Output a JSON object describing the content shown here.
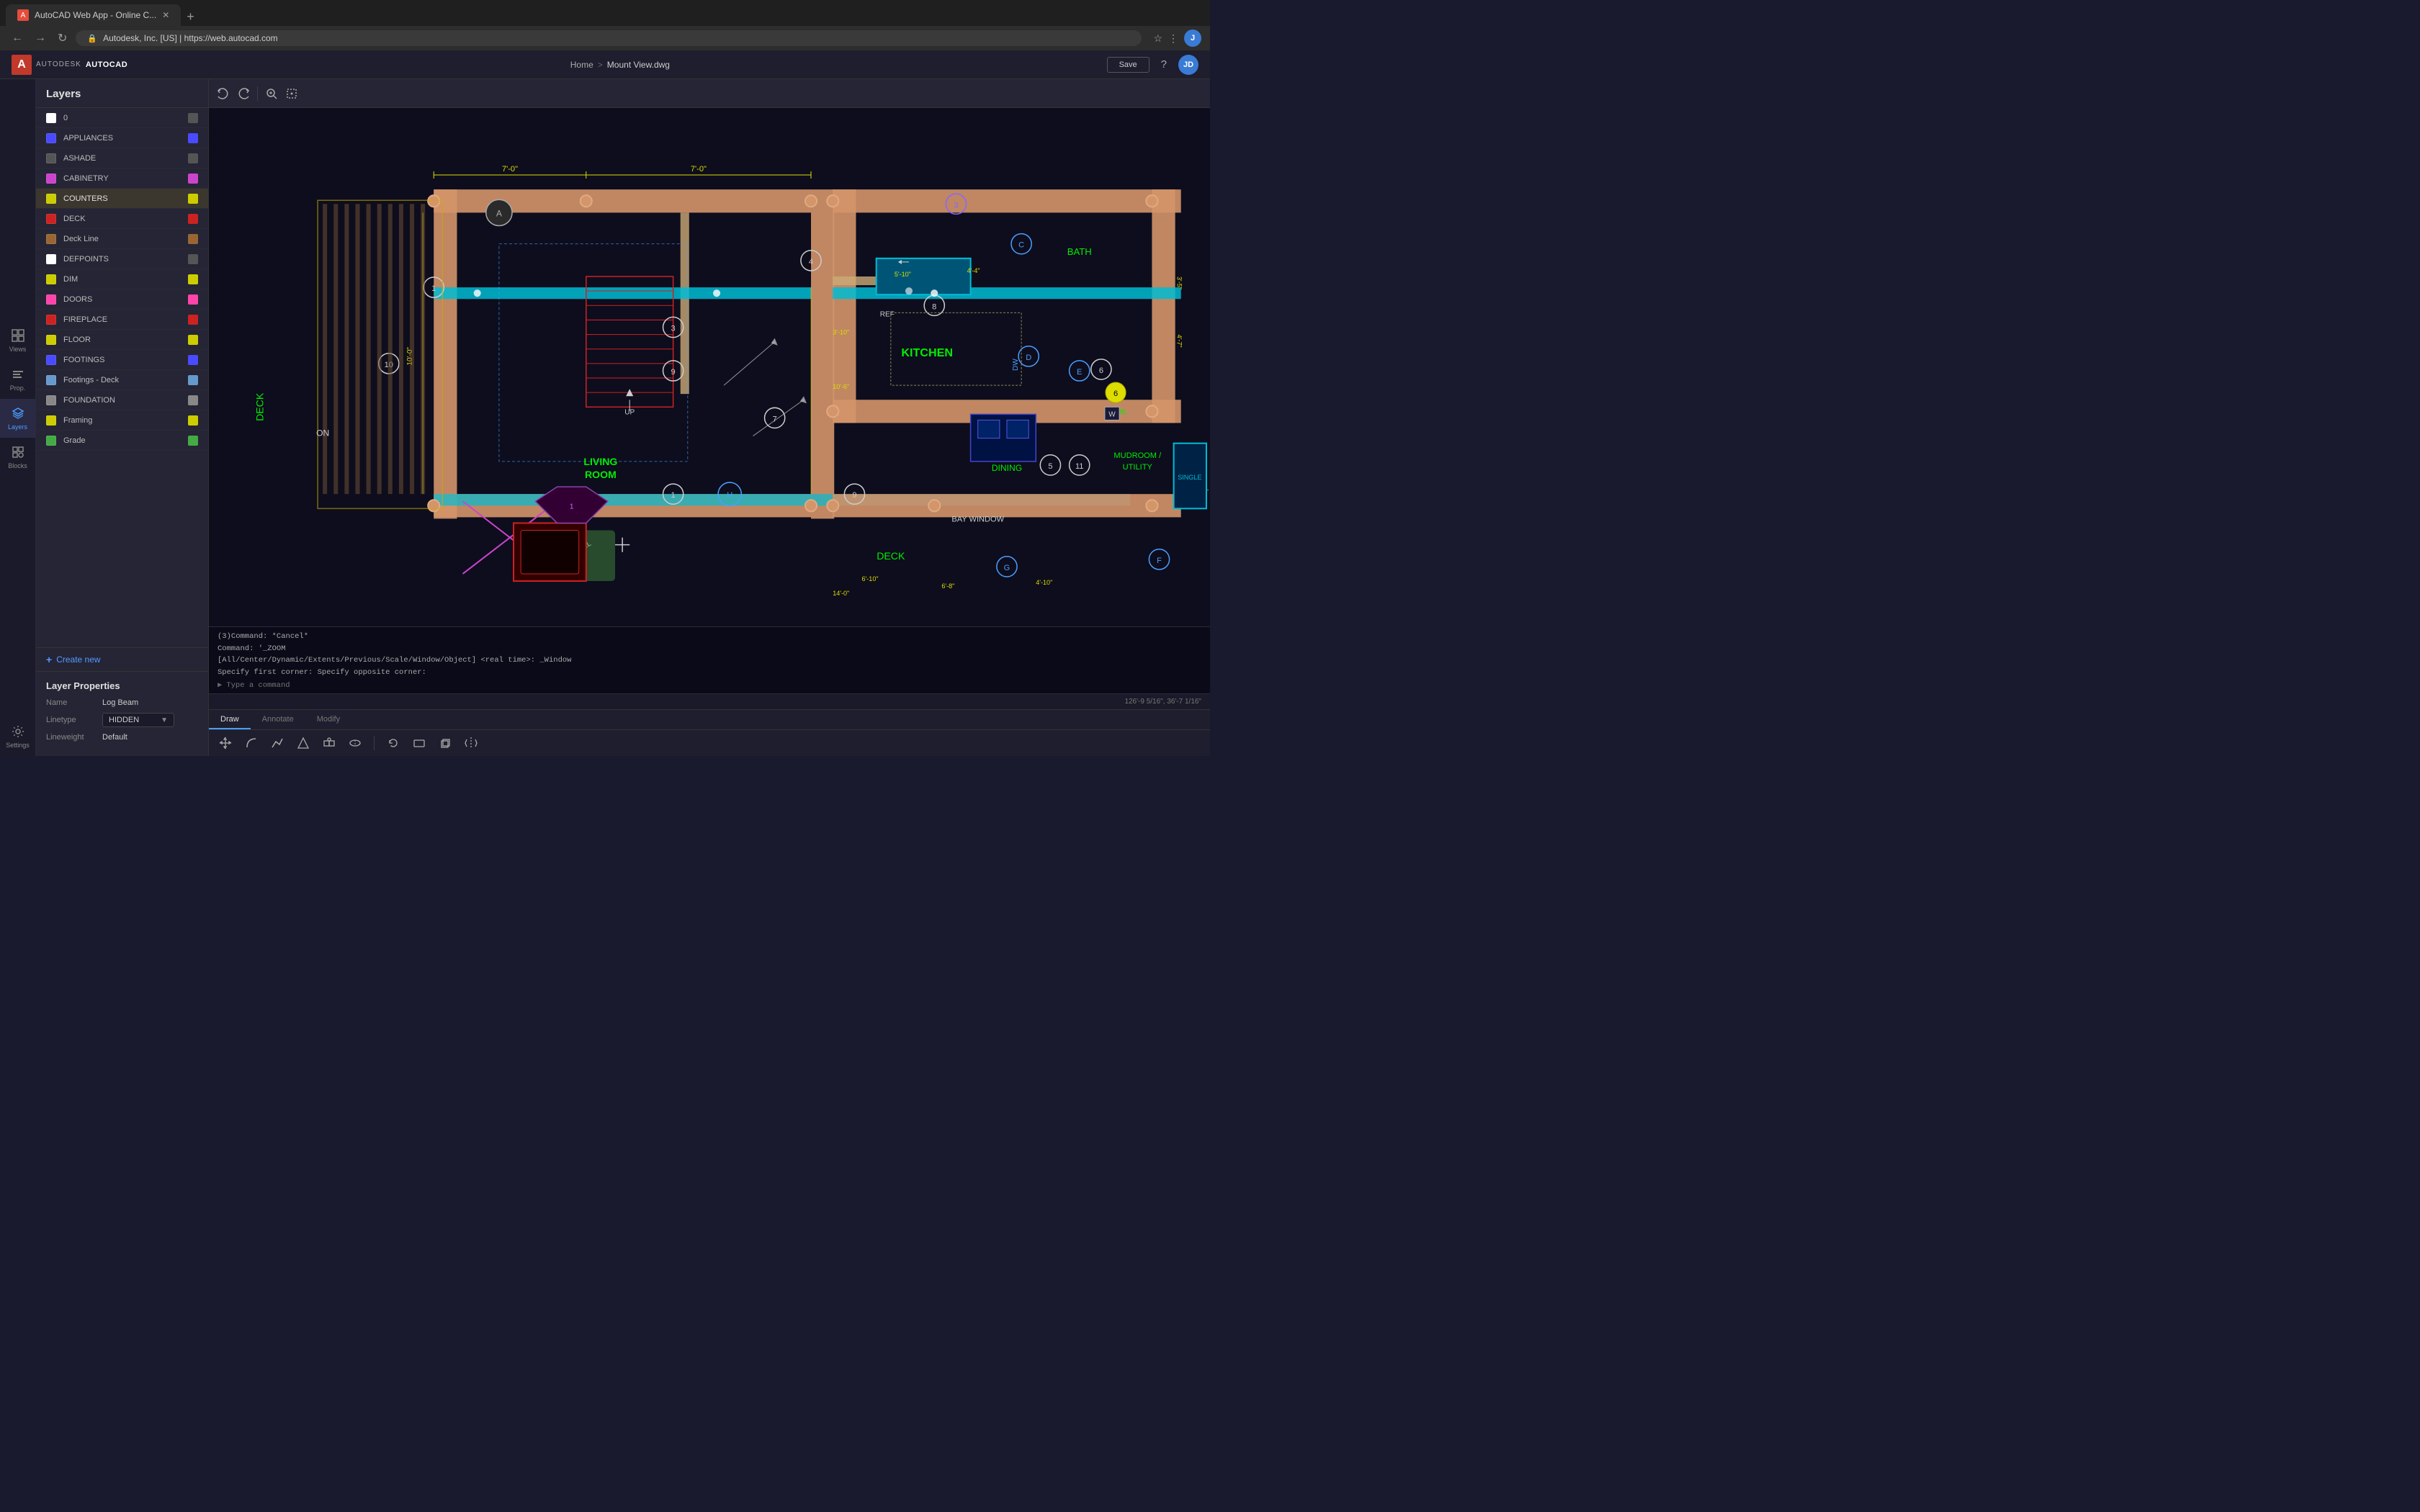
{
  "browser": {
    "tab_title": "AutoCAD Web App - Online C...",
    "tab_favicon": "A",
    "address": "Autodesk, Inc. [US] | https://web.autocad.com",
    "nav_back": "←",
    "nav_forward": "→",
    "nav_refresh": "↻",
    "new_tab": "+",
    "user_initial": "J"
  },
  "app": {
    "logo": "A",
    "autodesk_text": "AUTODESK",
    "autocad_text": "AUTOCAD",
    "save_label": "Save",
    "user_initial": "JD"
  },
  "breadcrumb": {
    "home": "Home",
    "separator": ">",
    "file": "Mount View.dwg"
  },
  "sidebar": {
    "views_label": "Views",
    "props_label": "Prop.",
    "layers_label": "Layers",
    "blocks_label": "Blocks",
    "settings_label": "Settings"
  },
  "layers": {
    "title": "Layers",
    "items": [
      {
        "name": "0",
        "color": "#ffffff"
      },
      {
        "name": "APPLIANCES",
        "color": "#4a4aff"
      },
      {
        "name": "ASHADE",
        "color": "#555555"
      },
      {
        "name": "CABINETRY",
        "color": "#cc44cc"
      },
      {
        "name": "COUNTERS",
        "color": "#cccc00",
        "highlighted": true
      },
      {
        "name": "DECK",
        "color": "#cc2222"
      },
      {
        "name": "Deck Line",
        "color": "#996633"
      },
      {
        "name": "DEFPOINTS",
        "color": "#ffffff"
      },
      {
        "name": "DIM",
        "color": "#cccc00"
      },
      {
        "name": "DOORS",
        "color": "#ff44aa"
      },
      {
        "name": "FIREPLACE",
        "color": "#cc2222"
      },
      {
        "name": "FLOOR",
        "color": "#cccc00"
      },
      {
        "name": "FOOTINGS",
        "color": "#4a4aff"
      },
      {
        "name": "Footings - Deck",
        "color": "#6699cc"
      },
      {
        "name": "FOUNDATION",
        "color": "#888888"
      },
      {
        "name": "Framing",
        "color": "#cccc00"
      },
      {
        "name": "Grade",
        "color": "#44aa44"
      }
    ],
    "create_new": "Create new"
  },
  "layer_properties": {
    "title": "Layer Properties",
    "name_label": "Name",
    "name_value": "Log Beam",
    "linetype_label": "Linetype",
    "linetype_value": "HIDDEN",
    "lineweight_label": "Lineweight",
    "lineweight_value": "Default"
  },
  "toolbar": {
    "undo": "↩",
    "redo": "↪",
    "search": "🔍",
    "select": "⊡",
    "back_arrow": "←",
    "forward_arrow": "→",
    "zoom_search": "🔎",
    "marquee": "⊡"
  },
  "bottom_tabs": {
    "draw": "Draw",
    "annotate": "Annotate",
    "modify": "Modify"
  },
  "command_line": {
    "line1": "(3)Command: *Cancel*",
    "line2": "Command: '_ZOOM",
    "line3": "[All/Center/Dynamic/Extents/Previous/Scale/Window/Object] <real time>: _Window",
    "line4": "Specify first corner: Specify opposite corner:",
    "placeholder": "Type a command"
  },
  "statusbar": {
    "coords": "126'-9 5/16\", 36'-7 1/16\""
  },
  "colors": {
    "bg_dark": "#0d0d1d",
    "panel_bg": "#252535",
    "header_bg": "#1e1e2e",
    "accent": "#4a9eff",
    "red": "#c0392b",
    "border": "#333344"
  }
}
